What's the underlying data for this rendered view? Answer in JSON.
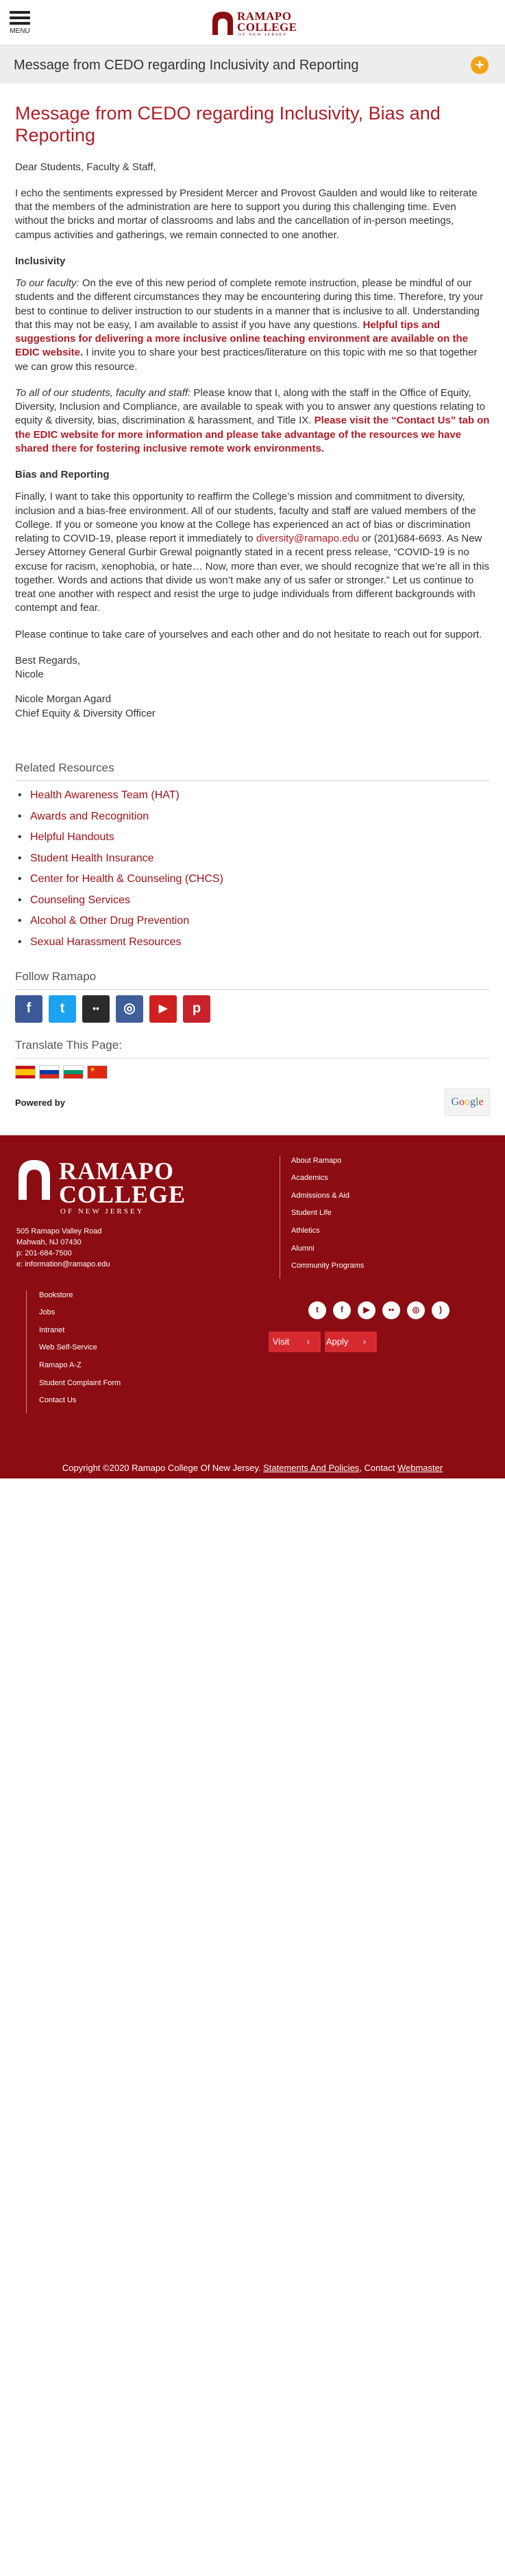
{
  "header": {
    "menu_label": "MENU",
    "logo": {
      "line1": "RAMAPO",
      "line2": "COLLEGE",
      "line3": "OF NEW JERSEY"
    }
  },
  "titlebar": {
    "title": "Message from CEDO regarding Inclusivity and Reporting",
    "expand_symbol": "+"
  },
  "article": {
    "title": "Message from CEDO regarding Inclusivity, Bias and Reporting",
    "greeting": "Dear Students, Faculty & Staff,",
    "intro": "I echo the sentiments expressed by President Mercer and Provost Gaulden and would like to reiterate that the members of the administration are here to support you during this challenging time.  Even without the bricks and mortar of classrooms and labs and the cancellation of in-person meetings, campus activities and gatherings, we remain connected to one another.",
    "inclusivity_heading": "Inclusivity",
    "faculty_lead": "To our faculty:",
    "faculty_text": " On the eve of this new period of complete remote instruction, please be mindful of our students and the different circumstances they may be encountering during this time. Therefore, try your best to continue to deliver instruction to our students in a manner that is inclusive to all. Understanding that this may not be easy, I am available to assist if you have any questions. ",
    "faculty_highlight": "Helpful tips and suggestions for delivering a more inclusive online teaching environment are available on the EDIC website.",
    "faculty_after": " I invite you to share your best practices/literature on this topic with me so that together we can grow this resource.",
    "all_lead": "To all of our students, faculty and staff:",
    "all_text": " Please know that I, along with the staff in the Office of Equity, Diversity, Inclusion and Compliance, are available to speak with you to answer any questions relating to equity & diversity, bias, discrimination & harassment, and Title IX. ",
    "all_highlight": "Please visit the “Contact Us” tab on the EDIC website for more information and please take advantage of the resources we have shared there for fostering inclusive remote work environments.",
    "bias_heading": "Bias and Reporting",
    "bias_text1": "Finally, I want to take this opportunity to reaffirm the College’s mission and commitment to diversity, inclusion and a bias-free environment.  All of our students, faculty and staff are valued members of the College.  If you or someone you know at the College has experienced an act of bias or discrimination relating to COVID-19, please report it immediately to ",
    "bias_email": "diversity@ramapo.edu",
    "bias_text2": " or (201)684-6693. As New Jersey Attorney General Gurbir Grewal poignantly stated in a recent press release, “COVID-19 is no excuse for racism, xenophobia, or hate… Now, more than ever, we should recognize that we’re all in this together. Words and actions that divide us won’t make any of us safer or stronger.” Let us continue to treat one another with respect and resist the urge to judge individuals from different backgrounds with contempt and fear.",
    "closing": "Please continue to take care of yourselves and each other and do not hesitate to reach out for support.",
    "regards": "Best Regards,",
    "regards_name": "Nicole",
    "sig_name": "Nicole Morgan Agard",
    "sig_title": "Chief Equity & Diversity Officer"
  },
  "related": {
    "heading": "Related Resources",
    "items": [
      "Health Awareness Team (HAT)",
      "Awards and Recognition",
      "Helpful Handouts",
      "Student Health Insurance",
      "Center for Health & Counseling (CHCS)",
      "Counseling Services",
      "Alcohol & Other Drug Prevention",
      "Sexual Harassment Resources"
    ]
  },
  "follow": {
    "heading": "Follow Ramapo",
    "icons": [
      {
        "name": "facebook-icon",
        "glyph": "f",
        "color": "#3b5998"
      },
      {
        "name": "twitter-icon",
        "glyph": "t",
        "color": "#1da1f2"
      },
      {
        "name": "flickr-icon",
        "glyph": "••",
        "color": "#2a2a2a"
      },
      {
        "name": "instagram-icon",
        "glyph": "◎",
        "color": "#3f5e9a"
      },
      {
        "name": "youtube-icon",
        "glyph": "▶",
        "color": "#cd201f"
      },
      {
        "name": "pinterest-icon",
        "glyph": "p",
        "color": "#c8232c"
      }
    ]
  },
  "translate": {
    "heading": "Translate This Page:",
    "flags": [
      "spanish-flag-icon",
      "russian-flag-icon",
      "bulgarian-flag-icon",
      "chinese-flag-icon"
    ],
    "powered_by": "Powered by",
    "google": "Google"
  },
  "footer": {
    "logo": {
      "line1": "RAMAPO",
      "line2": "COLLEGE",
      "line3": "OF NEW JERSEY"
    },
    "address": [
      "505 Ramapo Valley Road",
      "Mahwah, NJ 07430",
      "p: 201-684-7500",
      "e: information@ramapo.edu"
    ],
    "col_right": [
      "About Ramapo",
      "Academics",
      "Admissions & Aid",
      "Student Life",
      "Athletics",
      "Alumni",
      "Community Programs"
    ],
    "col_left": [
      "Bookstore",
      "Jobs",
      "Intranet",
      "Web Self-Service",
      "Ramapo A-Z",
      "Student Complaint Form",
      "Contact Us"
    ],
    "social": [
      "twitter-icon",
      "facebook-icon",
      "youtube-icon",
      "flickr-icon",
      "instagram-icon",
      "rss-icon"
    ],
    "social_glyphs": [
      "t",
      "f",
      "▶",
      "••",
      "◎",
      ")"
    ],
    "visit_label": "Visit",
    "apply_label": "Apply",
    "copyright": "Copyright ©2020 Ramapo College Of New Jersey.",
    "statements": "Statements And Policies",
    "contact": "Contact",
    "webmaster": "Webmaster"
  }
}
